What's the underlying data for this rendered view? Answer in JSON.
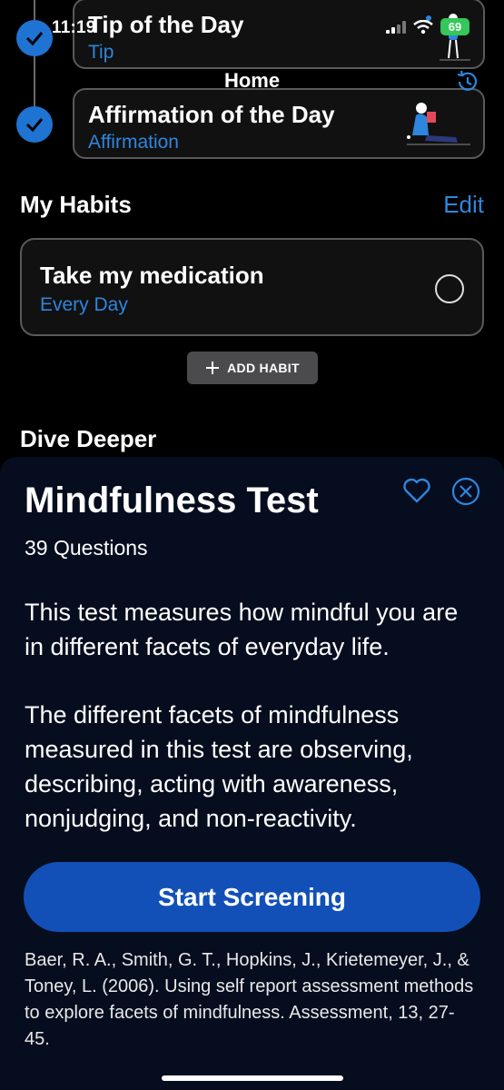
{
  "status_bar": {
    "time": "11:19",
    "battery": "69"
  },
  "header": {
    "title": "Home"
  },
  "daily": [
    {
      "title": "Tip of the Day",
      "subtitle": "Tip"
    },
    {
      "title": "Affirmation of the Day",
      "subtitle": "Affirmation"
    }
  ],
  "habits": {
    "title": "My Habits",
    "edit_label": "Edit",
    "items": [
      {
        "title": "Take my medication",
        "frequency": "Every Day"
      }
    ],
    "add_label": "ADD HABIT"
  },
  "dive_deeper": {
    "title": "Dive Deeper"
  },
  "sheet": {
    "title": "Mindfulness Test",
    "question_count": "39 Questions",
    "paragraphs": [
      "This test measures how mindful you are in different facets of everyday life.",
      "The different facets of mindfulness measured in this test are observing, describing, acting with awareness, nonjudging, and non-reactivity."
    ],
    "start_label": "Start Screening",
    "citation": "Baer, R. A., Smith, G. T., Hopkins, J., Krietemeyer, J., & Toney, L. (2006). Using self report assessment methods to explore facets of mindfulness. Assessment, 13, 27- 45."
  },
  "colors": {
    "accent": "#2e86de",
    "check": "#1f73d3",
    "button": "#1250b8",
    "sheet_bg": "#050d1e",
    "battery": "#34c759"
  },
  "icons": [
    "checkmark-icon",
    "signal-icon",
    "wifi-icon",
    "battery-icon",
    "history-icon",
    "plus-icon",
    "heart-icon",
    "close-icon"
  ]
}
